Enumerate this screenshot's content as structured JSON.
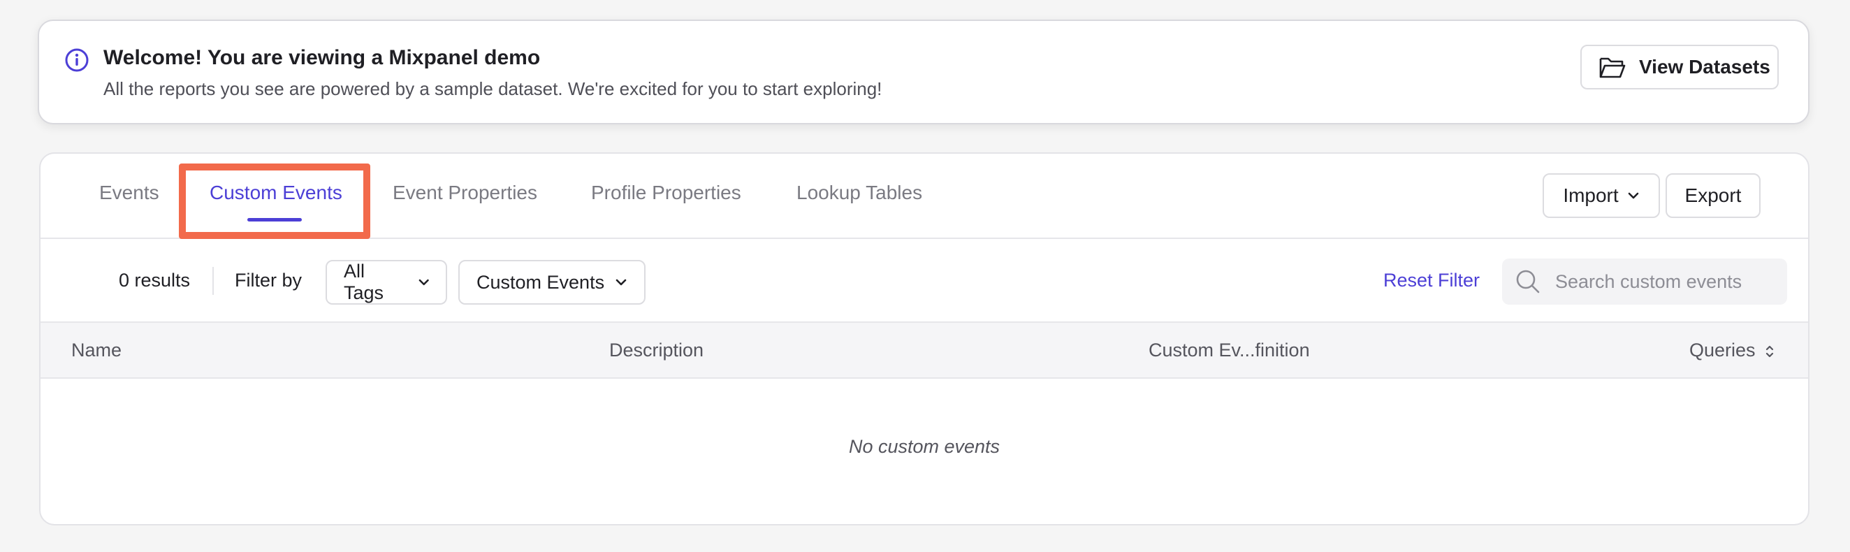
{
  "banner": {
    "title": "Welcome! You are viewing a Mixpanel demo",
    "text": "All the reports you see are powered by a sample dataset. We're excited for you to start exploring!",
    "button_label": "View Datasets"
  },
  "tabs": [
    {
      "label": "Events",
      "active": false
    },
    {
      "label": "Custom Events",
      "active": true
    },
    {
      "label": "Event Properties",
      "active": false
    },
    {
      "label": "Profile Properties",
      "active": false
    },
    {
      "label": "Lookup Tables",
      "active": false
    }
  ],
  "actions": {
    "import_label": "Import",
    "export_label": "Export"
  },
  "filter": {
    "results_text": "0 results",
    "filter_by_label": "Filter by",
    "tags_dropdown": "All Tags",
    "type_dropdown": "Custom Events",
    "reset_label": "Reset Filter",
    "search_placeholder": "Search custom events"
  },
  "table": {
    "columns": [
      "Name",
      "Description",
      "Custom Ev...finition",
      "Queries"
    ],
    "empty_message": "No custom events"
  },
  "colors": {
    "accent": "#4c3fd6",
    "highlight": "#f26a4b"
  }
}
